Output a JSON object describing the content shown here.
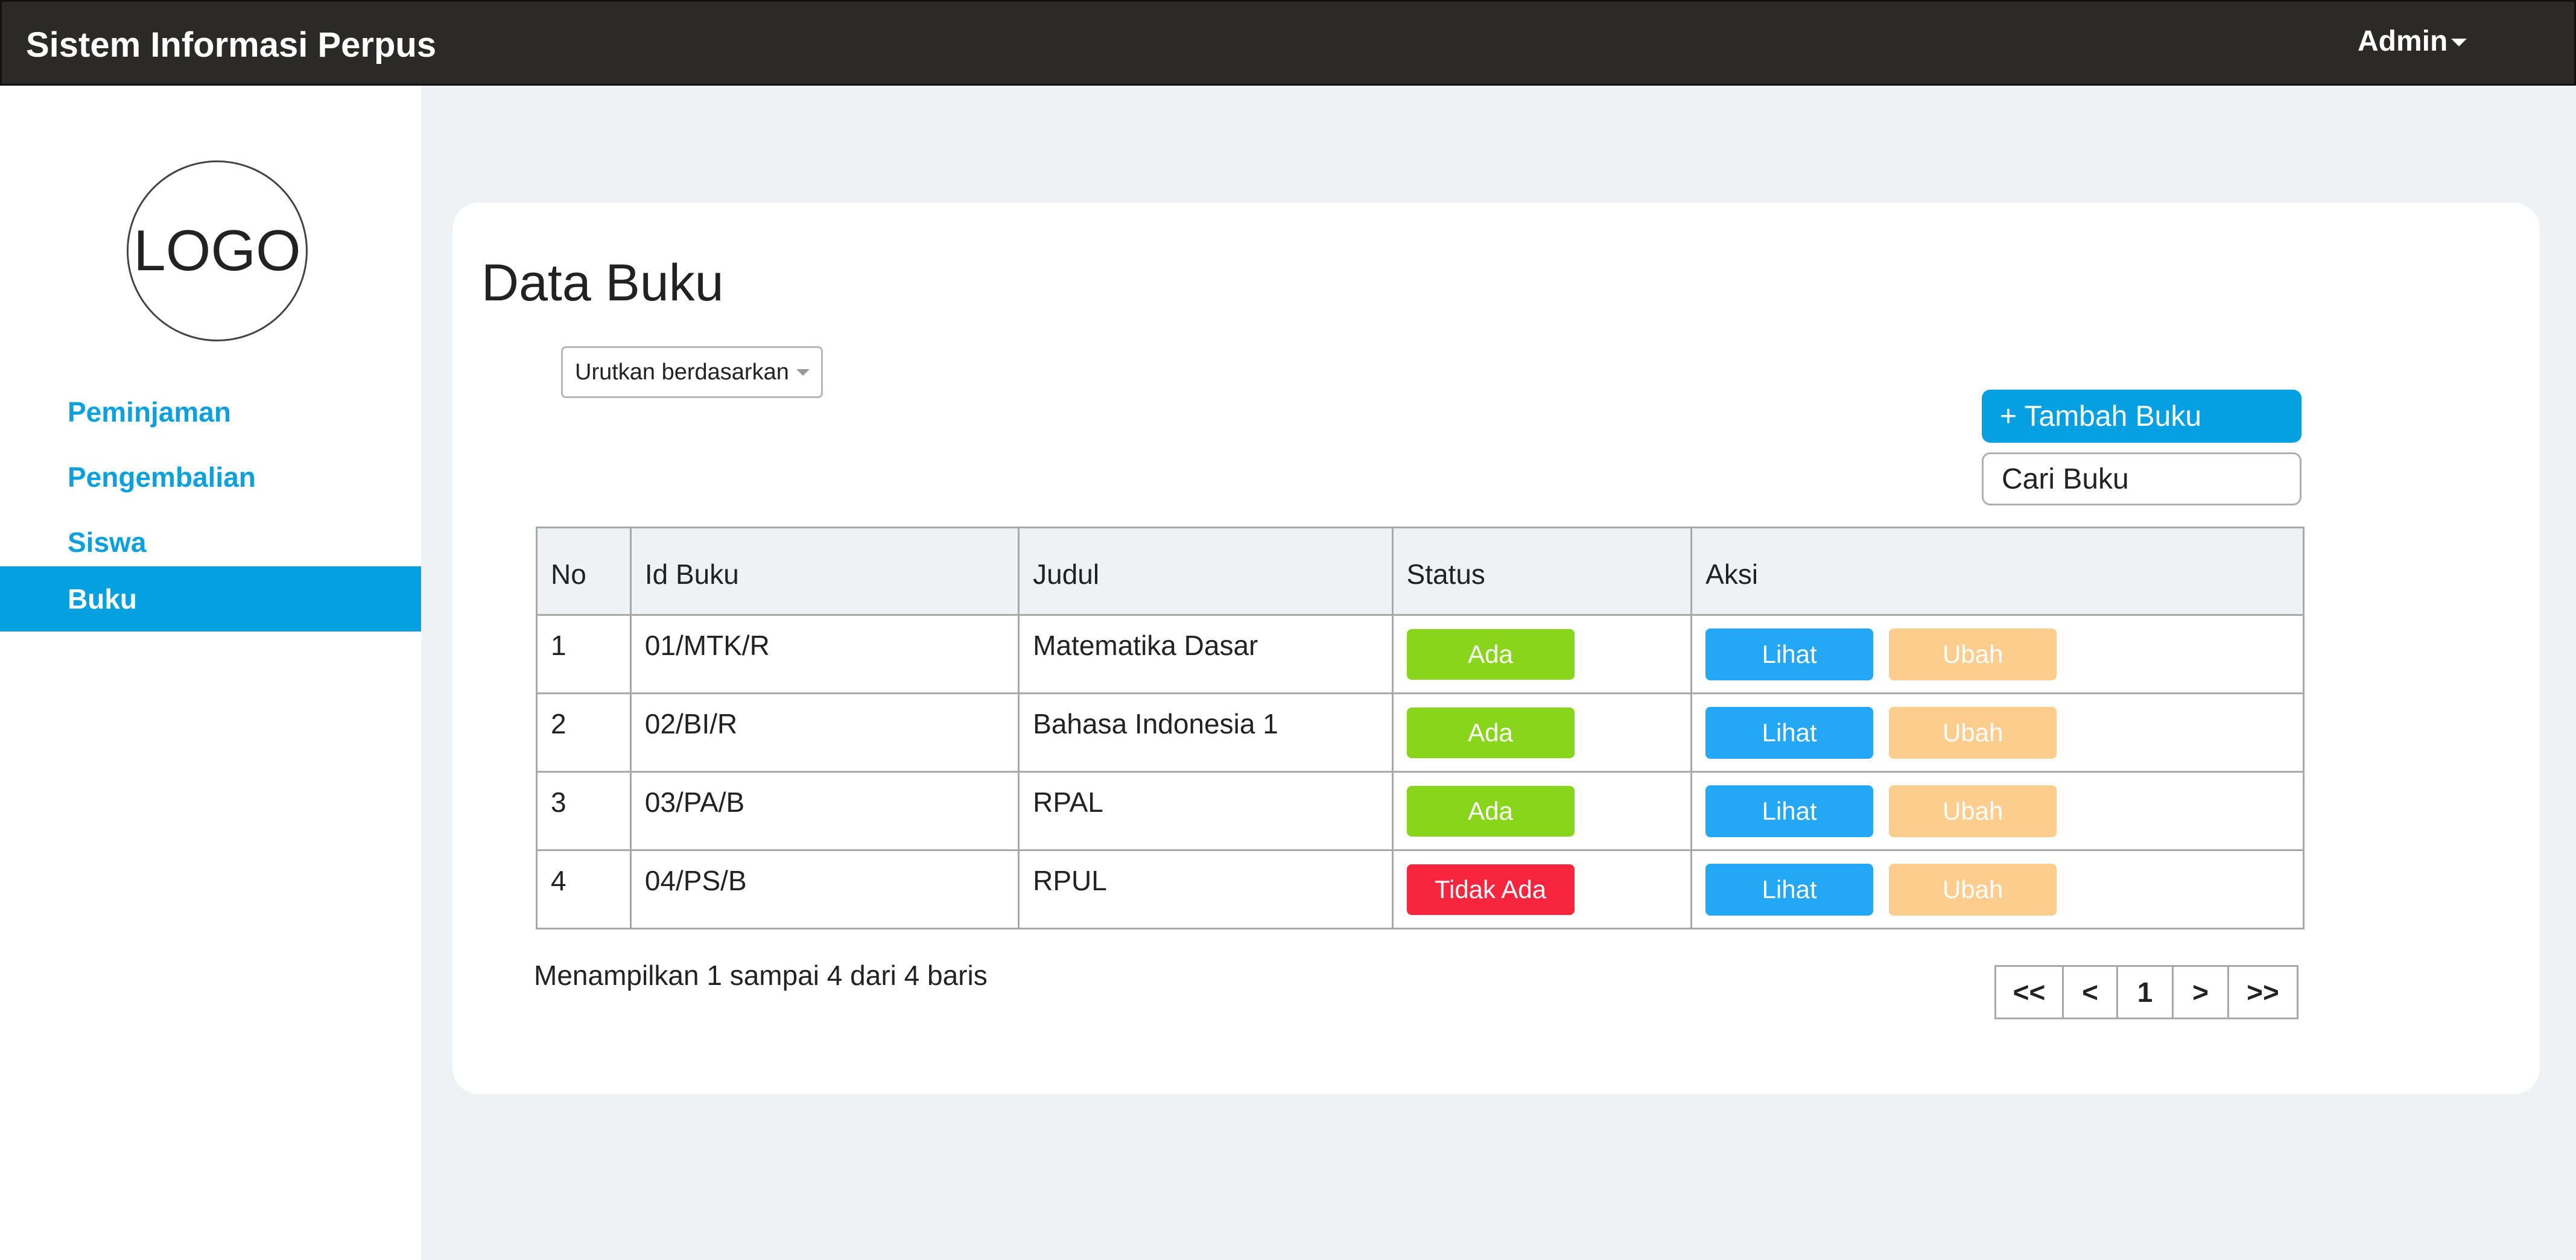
{
  "header": {
    "app_title": "Sistem Informasi Perpus",
    "user_menu_label": "Admin"
  },
  "sidebar": {
    "logo_text": "LOGO",
    "items": [
      {
        "label": "Peminjaman",
        "active": false
      },
      {
        "label": "Pengembalian",
        "active": false
      },
      {
        "label": "Siswa",
        "active": false
      },
      {
        "label": "Buku",
        "active": true
      }
    ]
  },
  "main": {
    "title": "Data Buku",
    "sort_select_label": "Urutkan berdasarkan",
    "add_button_label": "+ Tambah Buku",
    "search_placeholder": "Cari Buku",
    "table": {
      "columns": [
        "No",
        "Id Buku",
        "Judul",
        "Status",
        "Aksi"
      ],
      "rows": [
        {
          "no": "1",
          "id": "01/MTK/R",
          "title": "Matematika Dasar",
          "status": "Ada",
          "status_color": "#88d51b",
          "view": "Lihat",
          "edit": "Ubah"
        },
        {
          "no": "2",
          "id": "02/BI/R",
          "title": "Bahasa Indonesia 1",
          "status": "Ada",
          "status_color": "#88d51b",
          "view": "Lihat",
          "edit": "Ubah"
        },
        {
          "no": "3",
          "id": "03/PA/B",
          "title": "RPAL",
          "status": "Ada",
          "status_color": "#88d51b",
          "view": "Lihat",
          "edit": "Ubah"
        },
        {
          "no": "4",
          "id": "04/PS/B",
          "title": "RPUL",
          "status": "Tidak Ada",
          "status_color": "#f8253f",
          "view": "Lihat",
          "edit": "Ubah"
        }
      ]
    },
    "summary_text": "Menampilkan 1 sampai 4 dari 4 baris",
    "pagination": [
      "<<",
      "<",
      "1",
      ">",
      ">>"
    ]
  },
  "colors": {
    "topbar": "#2b2a29",
    "accent": "#05a0e0",
    "view_button": "#24a7f5",
    "edit_button": "#fccd8c",
    "available": "#88d51b",
    "unavailable": "#f8253f"
  }
}
